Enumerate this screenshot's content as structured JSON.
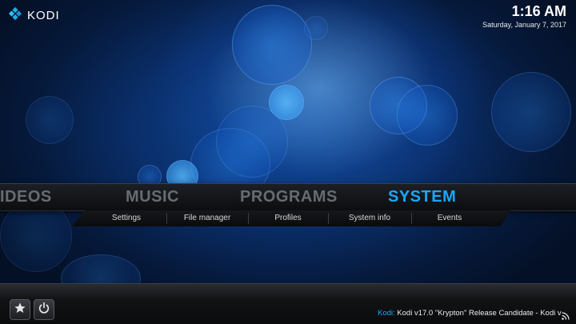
{
  "app": {
    "name": "KODI"
  },
  "clock": {
    "time": "1:16 AM",
    "date": "Saturday, January 7, 2017"
  },
  "main_menu": {
    "items": [
      {
        "label": "IDEOS"
      },
      {
        "label": "MUSIC"
      },
      {
        "label": "PROGRAMS"
      },
      {
        "label": "SYSTEM"
      }
    ],
    "active": "SYSTEM"
  },
  "submenu": {
    "items": [
      {
        "label": "Settings"
      },
      {
        "label": "File manager"
      },
      {
        "label": "Profiles"
      },
      {
        "label": "System info"
      },
      {
        "label": "Events"
      }
    ]
  },
  "ticker": {
    "source": "Kodi:",
    "text": "Kodi v17.0 \"Krypton\" Release Candidate - Kodi v"
  },
  "icons": {
    "logo": "kodi-logo-icon",
    "favourites": "star-icon",
    "power": "power-icon",
    "rss": "rss-icon"
  },
  "colors": {
    "accent": "#1aa7ff",
    "inactive_menu": "#686c72"
  }
}
